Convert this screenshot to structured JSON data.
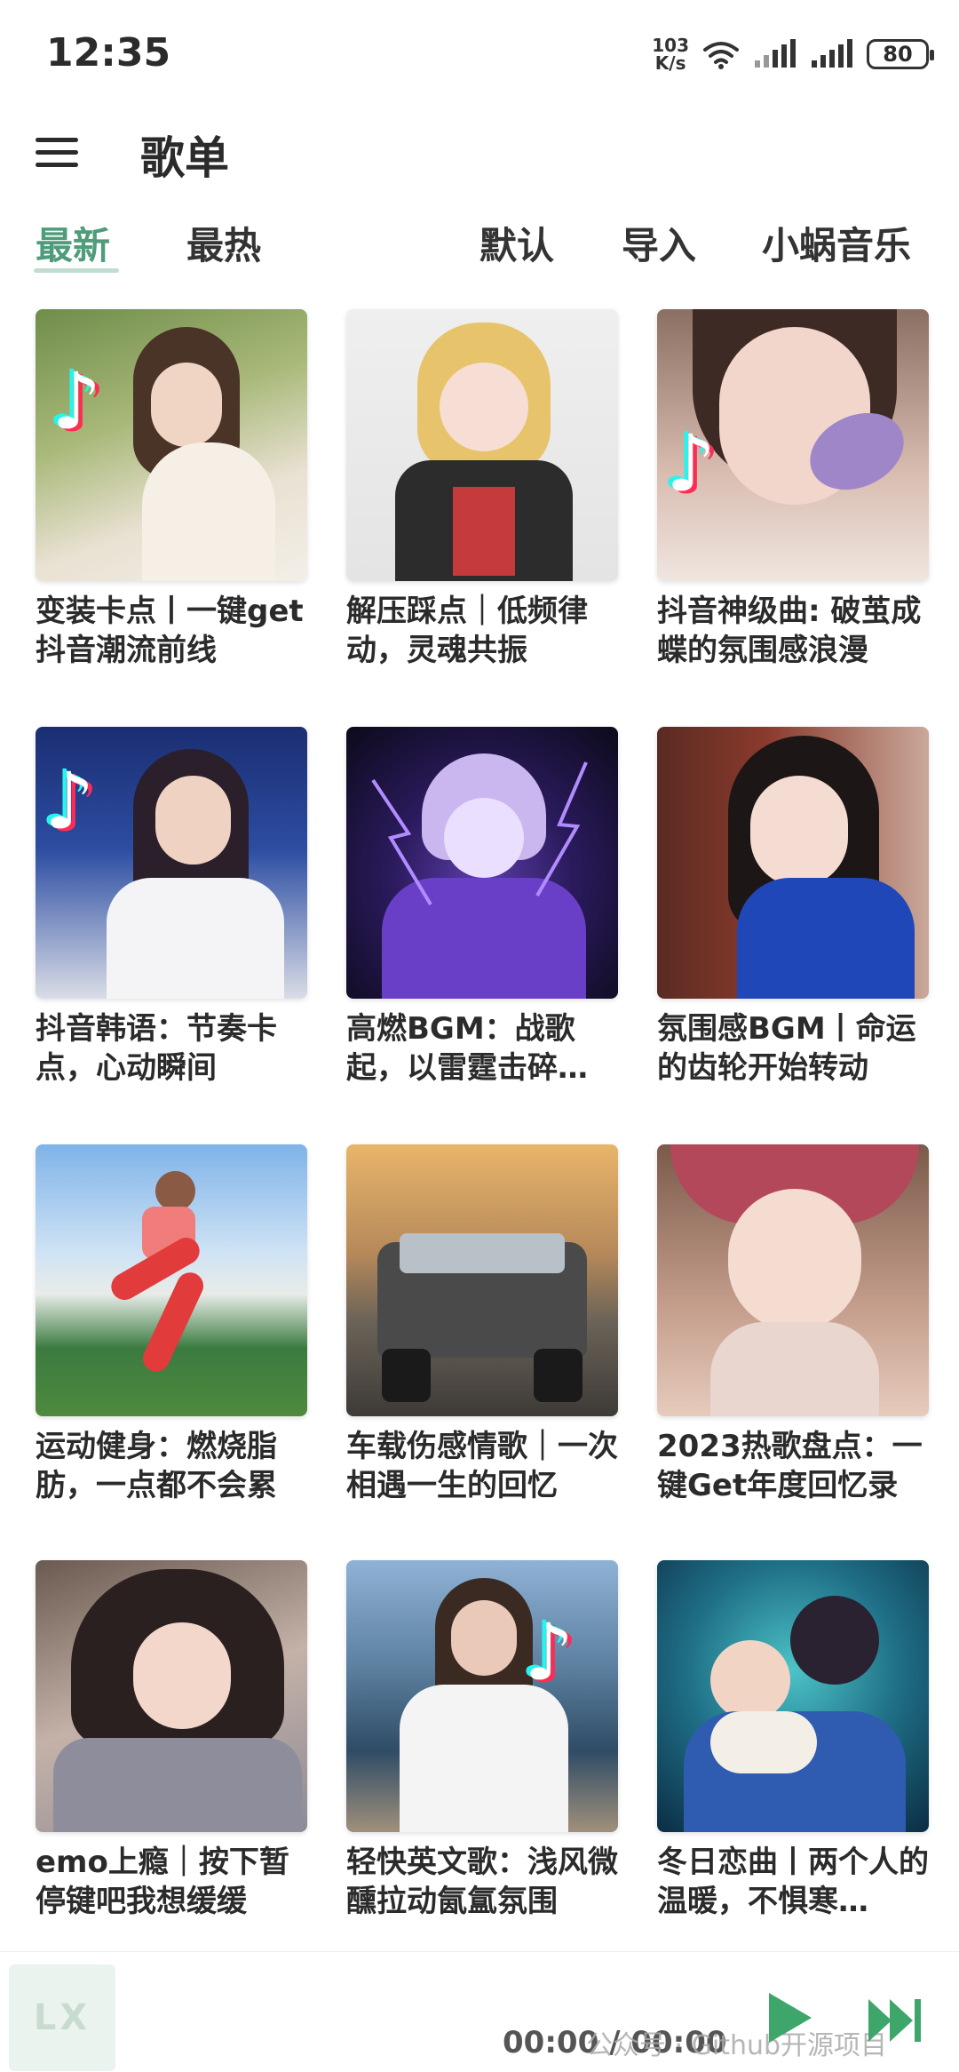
{
  "status": {
    "time": "12:35",
    "net_speed_value": "103",
    "net_speed_unit": "K/s",
    "battery": "80"
  },
  "header": {
    "title": "歌单"
  },
  "tabs": [
    {
      "label": "最新",
      "active": true
    },
    {
      "label": "最热",
      "active": false
    },
    {
      "label": "默认",
      "active": false
    },
    {
      "label": "导入",
      "active": false
    },
    {
      "label": "小蜗音乐",
      "active": false
    }
  ],
  "playlists": [
    {
      "title": "变装卡点丨一键get抖音潮流前线"
    },
    {
      "title": "解压踩点｜低频律动，灵魂共振"
    },
    {
      "title": "抖音神级曲: 破茧成蝶的氛围感浪漫"
    },
    {
      "title": "抖音韩语：节奏卡点，心动瞬间"
    },
    {
      "title": "高燃BGM：战歌起，以雷霆击碎…"
    },
    {
      "title": "氛围感BGM丨命运的齿轮开始转动"
    },
    {
      "title": "运动健身：燃烧脂肪，一点都不会累"
    },
    {
      "title": "车载伤感情歌｜一次相遇一生的回忆"
    },
    {
      "title": "2023热歌盘点：一键Get年度回忆录"
    },
    {
      "title": "emo上瘾｜按下暂停键吧我想缓缓"
    },
    {
      "title": "轻快英文歌：浅风微醺拉动氤氲氛围"
    },
    {
      "title": "冬日恋曲丨两个人的温暖，不惧寒…"
    }
  ],
  "player": {
    "logo_text": "LX",
    "time": "00:00 / 00:00",
    "watermark": "公众号 · Github开源项目"
  },
  "colors": {
    "accent": "#4f9c7a",
    "text": "#2b2b2b",
    "background": "#ffffff"
  },
  "icons": {
    "menu": "hamburger-menu-icon",
    "play": "play-icon",
    "next": "skip-next-icon",
    "wifi": "wifi-icon",
    "signal": "signal-icon",
    "battery": "battery-icon",
    "tiktok": "tiktok-note-icon"
  }
}
